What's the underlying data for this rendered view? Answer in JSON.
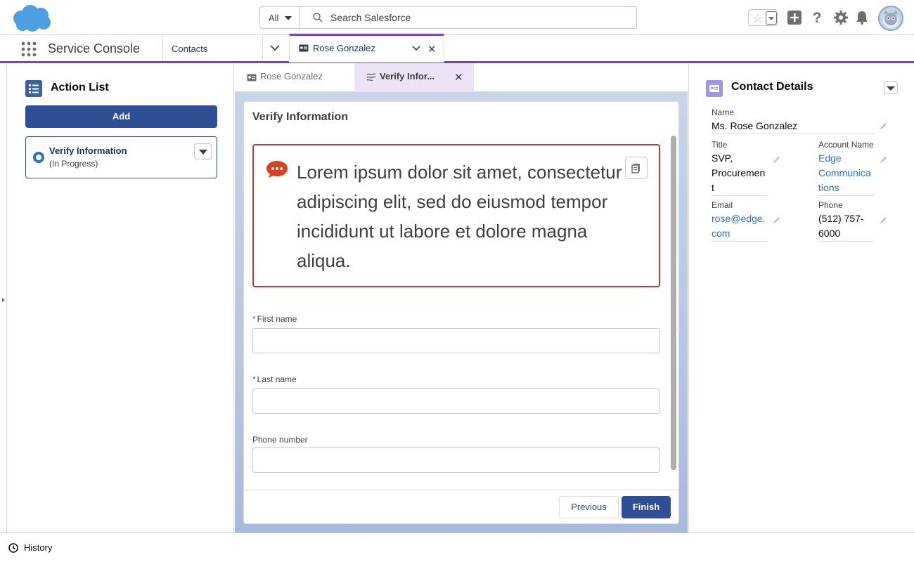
{
  "header": {
    "search_scope": "All",
    "search_placeholder": "Search Salesforce"
  },
  "navbar": {
    "app_name": "Service Console",
    "nav_item": "Contacts",
    "workspace_tab": "Rose Gonzalez"
  },
  "left": {
    "title": "Action List",
    "add_label": "Add",
    "item_name": "Verify Information",
    "item_status": "(In Progress)"
  },
  "center": {
    "subtab1": "Rose Gonzalez",
    "subtab2": "Verify Infor...",
    "flow_title": "Verify Information",
    "alert_text": "Lorem ipsum dolor sit amet, consectetur adipiscing elit, sed do eiusmod tempor incididunt ut labore et dolore magna aliqua.",
    "fields": [
      {
        "label": "First name",
        "required": "*"
      },
      {
        "label": "Last name",
        "required": "*"
      },
      {
        "label": "Phone number"
      }
    ],
    "previous_label": "Previous",
    "finish_label": "Finish"
  },
  "right": {
    "title": "Contact Details",
    "name_label": "Name",
    "name_value": "Ms. Rose Gonzalez",
    "title_label": "Title",
    "title_value_lines": [
      "SVP,",
      "Procuremen",
      "t"
    ],
    "account_label": "Account Name",
    "account_value_lines": [
      "Edge",
      "Communica",
      "tions"
    ],
    "email_label": "Email",
    "email_value_lines": [
      "rose@edge.",
      "com"
    ],
    "phone_label": "Phone",
    "phone_value_lines": [
      "(512) 757-",
      "6000"
    ]
  },
  "bottom": {
    "history_label": "History"
  },
  "colors": {
    "accent_purple": "#7f3fbf",
    "brand_blue": "#2e4f93",
    "error_red": "#c23934",
    "link_blue": "#2e6fd6"
  }
}
